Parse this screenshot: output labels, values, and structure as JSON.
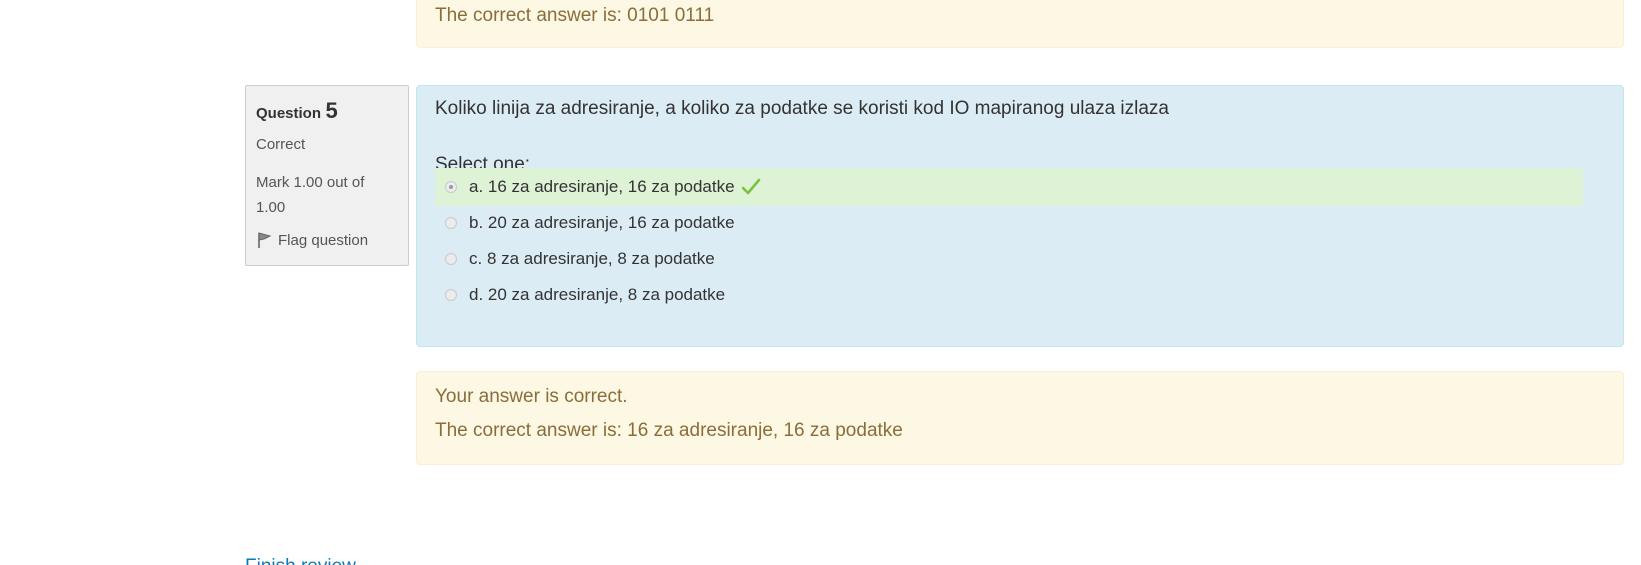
{
  "previous_question": {
    "right_answer": "The correct answer is: 0101 0111"
  },
  "question": {
    "label": "Question",
    "number": "5",
    "state": "Correct",
    "grade": "Mark 1.00 out of 1.00",
    "flag_label": "Flag question",
    "text": "Koliko linija za adresiranje, a koliko za podatke se koristi kod IO mapiranog ulaza izlaza",
    "prompt": "Select one:",
    "answers": [
      {
        "label": "a. 16 za adresiranje, 16 za podatke",
        "selected": true,
        "correct": true
      },
      {
        "label": "b. 20 za adresiranje, 16 za podatke",
        "selected": false,
        "correct": false
      },
      {
        "label": "c. 8 za adresiranje, 8 za podatke",
        "selected": false,
        "correct": false
      },
      {
        "label": "d. 20 za adresiranje, 8 za podatke",
        "selected": false,
        "correct": false
      }
    ],
    "feedback": "Your answer is correct.",
    "right_answer": "The correct answer is: 16 za adresiranje, 16 za podatke"
  },
  "footer": {
    "finish_link": "Finish review"
  },
  "colors": {
    "info_bg": "#f0f0f0",
    "content_bg": "#dcecf5",
    "correct_bg": "#def2d6",
    "feedback_bg": "#fcf8e3",
    "feedback_text": "#8a6d3b",
    "tick": "#7cc242",
    "link": "#0a7ab8"
  },
  "icons": {
    "flag": "flag-icon",
    "correct": "check-icon"
  }
}
